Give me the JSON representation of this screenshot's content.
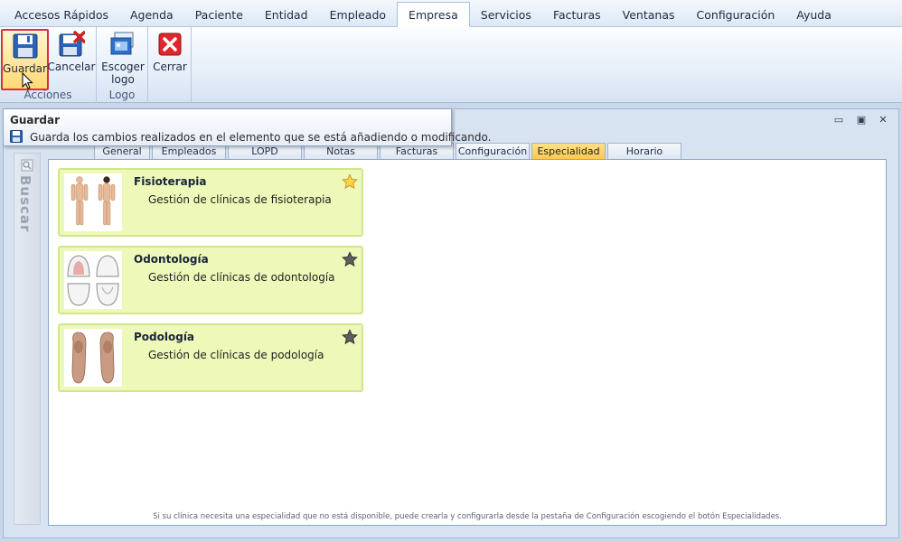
{
  "menu": {
    "tabs": [
      {
        "label": "Accesos Rápidos",
        "active": false
      },
      {
        "label": "Agenda",
        "active": false
      },
      {
        "label": "Paciente",
        "active": false
      },
      {
        "label": "Entidad",
        "active": false
      },
      {
        "label": "Empleado",
        "active": false
      },
      {
        "label": "Empresa",
        "active": true
      },
      {
        "label": "Servicios",
        "active": false
      },
      {
        "label": "Facturas",
        "active": false
      },
      {
        "label": "Ventanas",
        "active": false
      },
      {
        "label": "Configuración",
        "active": false
      },
      {
        "label": "Ayuda",
        "active": false
      }
    ]
  },
  "ribbon": {
    "groups": {
      "acciones": {
        "label": "Acciones"
      },
      "logo": {
        "label": "Logo"
      }
    },
    "buttons": {
      "guardar": "Guardar",
      "cancelar": "Cancelar",
      "escoger_logo_1": "Escoger",
      "escoger_logo_2": "logo",
      "cerrar": "Cerrar"
    }
  },
  "tooltip": {
    "title": "Guardar",
    "text": "Guarda los cambios realizados en el elemento que se está añadiendo o modificando."
  },
  "window": {
    "controls": {
      "minimize": "▭",
      "restore": "▣",
      "close": "✕"
    }
  },
  "sidebar": {
    "search_label": "Buscar"
  },
  "tabs": [
    {
      "label": "General"
    },
    {
      "label": "Empleados"
    },
    {
      "label": "LOPD"
    },
    {
      "label": "Notas"
    },
    {
      "label": "Facturas"
    },
    {
      "label": "Configuración"
    },
    {
      "label": "Especialidad",
      "active": true
    },
    {
      "label": "Horario"
    }
  ],
  "specialties": [
    {
      "title": "Fisioterapia",
      "description": "Gestión de clínicas de fisioterapia",
      "favorite": true
    },
    {
      "title": "Odontología",
      "description": "Gestión de clínicas de odontología",
      "favorite": false
    },
    {
      "title": "Podología",
      "description": "Gestión de clínicas de podología",
      "favorite": false
    }
  ],
  "footnote": "Si su clínica necesita una especialidad que no está disponible, puede crearla y configurarla desde la pestaña de Configuración escogiendo el botón Especialidades.",
  "colors": {
    "accent_tab": "#ffc94a",
    "card_bg": "#eef8b8",
    "card_border": "#cfe78a",
    "save_highlight": "#d9303a"
  }
}
